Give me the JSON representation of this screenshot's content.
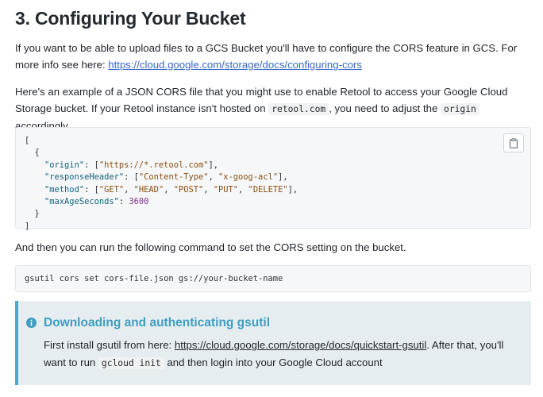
{
  "heading": "3. Configuring Your Bucket",
  "intro": {
    "text": "If you want to be able to upload files to a GCS Bucket you'll have to configure the CORS feature in GCS. For more info see here: ",
    "link": "https://cloud.google.com/storage/docs/configuring-cors"
  },
  "example": {
    "before": "Here's an example of a JSON CORS file that you might use to enable Retool to access your Google Cloud Storage bucket. If your Retool instance isn't hosted on ",
    "code1": "retool.com",
    "middle": ", you need to adjust the ",
    "code2": "origin",
    "after": " accordingly."
  },
  "json_block": {
    "open": "[",
    "inner_open": "{",
    "lines": [
      {
        "key": "\"origin\"",
        "rest": ": [",
        "strs": [
          "\"https://*.retool.com\""
        ],
        "tail": "],"
      },
      {
        "key": "\"responseHeader\"",
        "rest": ": [",
        "strs": [
          "\"Content-Type\"",
          "\"x-goog-acl\""
        ],
        "tail": "],"
      },
      {
        "key": "\"method\"",
        "rest": ": [",
        "strs": [
          "\"GET\"",
          "\"HEAD\"",
          "\"POST\"",
          "\"PUT\"",
          "\"DELETE\""
        ],
        "tail": "],"
      },
      {
        "key": "\"maxAgeSeconds\"",
        "rest": ": ",
        "num": "3600",
        "tail": ""
      }
    ],
    "inner_close": "}",
    "close": "]"
  },
  "then_text": "And then you can run the following command to set the CORS setting on the bucket.",
  "command": "gsutil cors set cors-file.json gs://your-bucket-name",
  "note": {
    "title": "Downloading and authenticating gsutil",
    "before": "First install gsutil from here: ",
    "link": "https://cloud.google.com/storage/docs/quickstart-gsutil",
    "middle": ". After that, you'll want to run ",
    "code": "gcloud init",
    "after": " and then login into your Google Cloud account"
  },
  "icons": {
    "copy": "clipboard-icon",
    "info": "info-icon"
  },
  "colors": {
    "link": "#3867c6",
    "note_accent": "#4aa8c8",
    "note_bg": "#e6edf0"
  }
}
